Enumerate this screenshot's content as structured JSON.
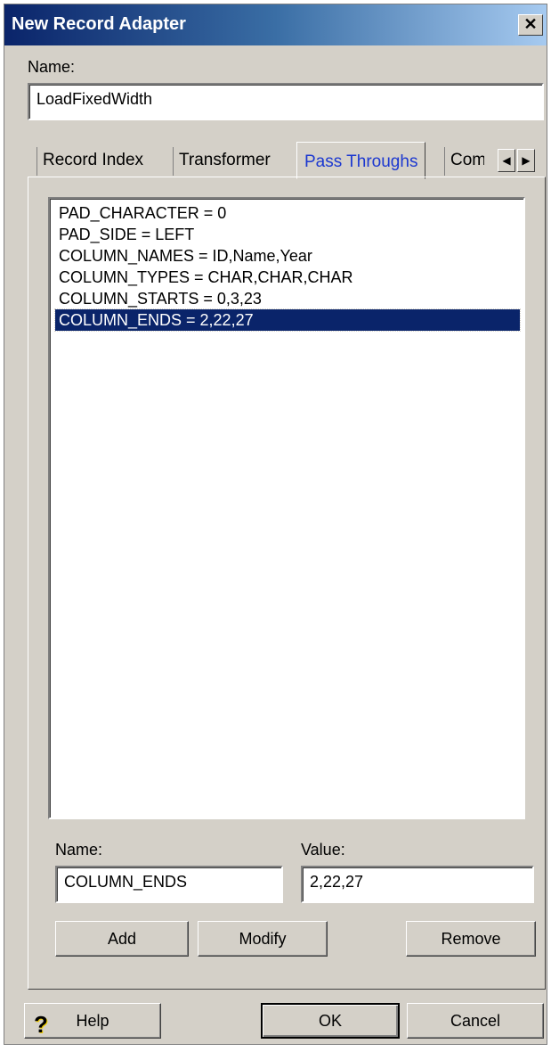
{
  "window": {
    "title": "New Record Adapter"
  },
  "name_field": {
    "label": "Name:",
    "value": "LoadFixedWidth"
  },
  "tabs": [
    {
      "label": "Record Index"
    },
    {
      "label": "Transformer"
    },
    {
      "label": "Pass Throughs",
      "active": true
    },
    {
      "label": "Com"
    }
  ],
  "pass_throughs": {
    "items": [
      "PAD_CHARACTER = 0",
      "PAD_SIDE = LEFT",
      "COLUMN_NAMES = ID,Name,Year",
      "COLUMN_TYPES = CHAR,CHAR,CHAR",
      "COLUMN_STARTS = 0,3,23",
      "COLUMN_ENDS = 2,22,27"
    ],
    "selected_index": 5,
    "name_label": "Name:",
    "name_value": "COLUMN_ENDS",
    "value_label": "Value:",
    "value_value": "2,22,27",
    "add_label": "Add",
    "modify_label": "Modify",
    "remove_label": "Remove"
  },
  "footer": {
    "help_label": "Help",
    "ok_label": "OK",
    "cancel_label": "Cancel"
  },
  "colors": {
    "title_start": "#0a246a",
    "selection": "#0a246a",
    "active_tab_text": "#1c38d0",
    "face": "#d4d0c8"
  }
}
